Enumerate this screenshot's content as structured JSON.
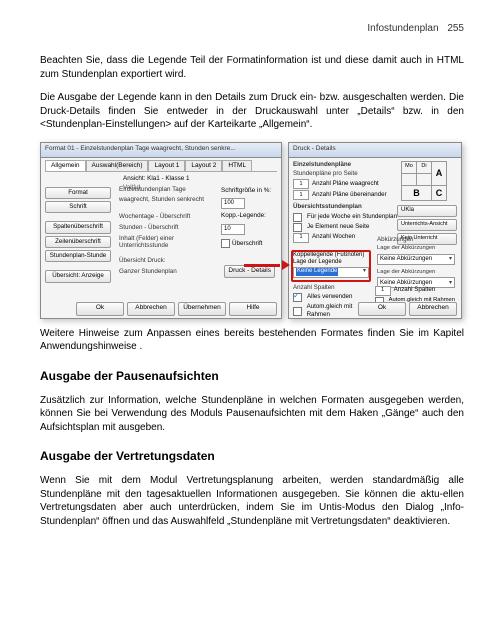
{
  "header": {
    "section": "Infostundenplan",
    "page_number": "255"
  },
  "body": {
    "p1": "Beachten Sie, dass die Legende Teil der Formatinformation ist und diese damit auch in HTML zum Stundenplan exportiert wird.",
    "p2": "Die Ausgabe der Legende kann in den Details zum Druck ein- bzw. ausgeschalten werden. Die Druck-Details finden Sie entweder in der Druckauswahl unter „Details“ bzw. in den <Stundenplan-Einstellungen> auf der Karteikarte „Allgemein“.",
    "p3": "Weitere Hinweise zum Anpassen eines bereits bestehenden Formates finden Sie im Kapitel Anwendungshinweise .",
    "h2a": "Ausgabe der Pausenaufsichten",
    "p4": "Zusätzlich zur Information, welche Stundenpläne in welchen Formaten ausgegeben werden, können Sie bei Verwendung des Moduls Pausenaufsichten mit dem Haken „Gänge“ auch den Aufsichtsplan mit ausgeben.",
    "h2b": "Ausgabe der Vertretungsdaten",
    "p5": "Wenn Sie mit dem Modul Vertretungsplanung arbeiten, werden standardmäßig alle Stundenpläne mit den tagesaktuellen Informationen ausgegeben. Sie können die aktu-ellen Vertretungsdaten aber auch unterdrücken, indem Sie im Untis-Modus den Dialog „Info-Stundenplan“ öffnen und das Auswahlfeld „Stundenpläne mit Vertretungsdaten“ deaktivieren."
  },
  "dlg_left": {
    "title": "Format 01 - Einzelstundenplan Tage waagrecht, Stunden senkre...",
    "tabs": [
      "Allgemein",
      "Auswahl(Bereich)",
      "Layout 1",
      "Layout 2",
      "HTML"
    ],
    "format_label": "Format",
    "format_name1": "Einzelstundenplan Tage",
    "format_name2": "waagrecht, Stunden senkrecht",
    "side": {
      "schrift": "Schrift",
      "spaltenbesch": "Spaltenüberschrift",
      "zeilenbesch": "Zeilenüberschrift",
      "stundenplanstd": "Stundenplan-Stunde",
      "uebersicht": "Übersicht: Anzeige"
    },
    "mid": {
      "wochentage": "Wochentage - Überschrift",
      "stunden": "Stunden - Überschrift",
      "inhalt": "Inhalt (Felder) einer Unterrichtsstunde",
      "uebersicht_druck": "Übersicht Druck:",
      "ganzer_stpl": "Ganzer Stundenplan"
    },
    "right": {
      "schriftgroesse_label": "Schriftgröße in %:",
      "schriftgroesse_val": "100",
      "kopp_label": "Kopp.-Legende:",
      "kopp_val": "10",
      "ueberschrift": "Überschrift"
    },
    "druck_details_btn": "Druck - Details",
    "footer": [
      "Ok",
      "Abbrechen",
      "Übernehmen",
      "Hilfe"
    ],
    "preview_label": "Ansicht: Kla1 - Klasse 1",
    "preview_sub": "Vall1d"
  },
  "dlg_right": {
    "title": "Druck - Details",
    "grp1_title": "Einzelstundenpläne",
    "grp1_sub": "Stundenpläne pro Seite",
    "field_anzahl_waag": "Anzahl Pläne waagrecht",
    "val_waag": "1",
    "field_anzahl_senk": "Anzahl Pläne übereinander",
    "val_senk": "1",
    "grp2_title": "Übersichtsstundenplan",
    "chk_jede_woche": "Für jede Woche ein Stundenplan",
    "chk_je_element": "Je Element neue Seite",
    "field_anzahl_wochen": "Anzahl Wochen",
    "val_wochen": "1",
    "btn_ukl": "UKla",
    "btn_unterricht_ansicht": "Unterrichts-Ansicht",
    "btn_kein_unterricht": "Kein Unterricht",
    "abk_label": "Abkürzungen",
    "abk_opt1": "Lage der Abkürzungen",
    "abk_opt2": "Keine Abkürzungen",
    "legend_group": "Koppellegende (Fußnoten)",
    "legend_lbl": "Lage der Legende",
    "legend_options": [
      "Keine Legende"
    ],
    "legend_selected": "Keine Legende",
    "lage_abk": "Lage der Abkürzungen",
    "lage_abk_val": "Keine Abkürzungen",
    "anzahl_spalten": "Anzahl Spalten",
    "anzahl_spalten_val": "1",
    "chk_alles_verwenden": "Alles verwenden",
    "chk_autom_rahmen": "Autom.gleich mit Rahmen",
    "footer": [
      "Ok",
      "Abbrechen"
    ],
    "grid_labels": {
      "a": "A",
      "b": "B",
      "c": "C",
      "tl": "Mo",
      "tr": "Di"
    }
  }
}
